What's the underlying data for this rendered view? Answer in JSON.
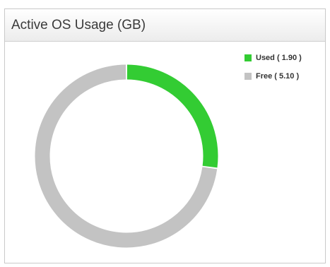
{
  "panel": {
    "title": "Active OS Usage (GB)"
  },
  "chart_data": {
    "type": "pie",
    "variant": "donut",
    "title": "Active OS Usage (GB)",
    "slices": [
      {
        "name": "Used",
        "value": 1.9,
        "label": "Used ( 1.90 )",
        "color": "#33cc33"
      },
      {
        "name": "Free",
        "value": 5.1,
        "label": "Free ( 5.10 )",
        "color": "#c3c3c3"
      }
    ],
    "legend_position": "top-right"
  }
}
